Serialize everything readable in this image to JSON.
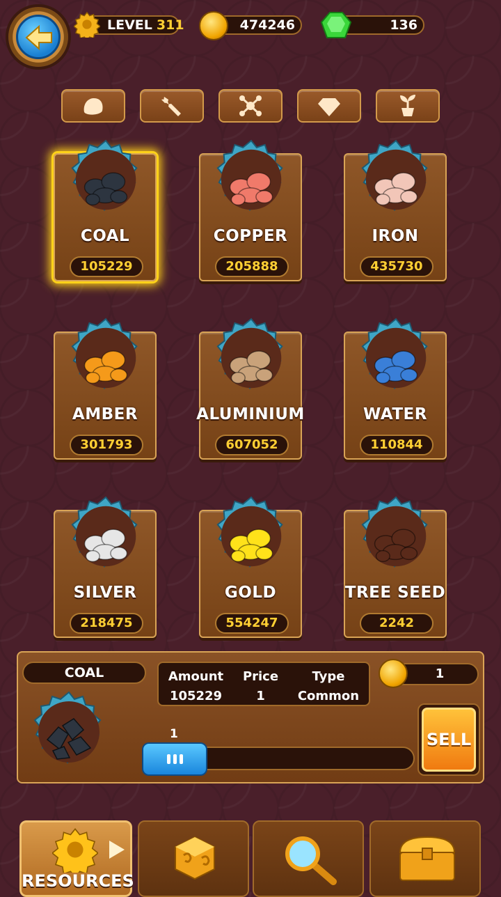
{
  "header": {
    "level_label": "LEVEL",
    "level_value": "311",
    "coins": "474246",
    "gems": "136"
  },
  "tabs": [
    {
      "icon": "rock-icon"
    },
    {
      "icon": "wrench-icon"
    },
    {
      "icon": "molecule-icon"
    },
    {
      "icon": "diamond-icon"
    },
    {
      "icon": "sprout-icon"
    }
  ],
  "resources": [
    {
      "name": "COAL",
      "amount": "105229",
      "color": "#2d3540"
    },
    {
      "name": "COPPER",
      "amount": "205888",
      "color": "#f07a6a"
    },
    {
      "name": "IRON",
      "amount": "435730",
      "color": "#f2c6b8"
    },
    {
      "name": "AMBER",
      "amount": "301793",
      "color": "#f59a1a"
    },
    {
      "name": "ALUMINIUM",
      "amount": "607052",
      "color": "#c9a27a"
    },
    {
      "name": "WATER",
      "amount": "110844",
      "color": "#3a7fd8"
    },
    {
      "name": "SILVER",
      "amount": "218475",
      "color": "#e6e6e6"
    },
    {
      "name": "GOLD",
      "amount": "554247",
      "color": "#ffe21a"
    },
    {
      "name": "TREE SEED",
      "amount": "2242",
      "color": "#5a2a1a"
    }
  ],
  "selected_index": 0,
  "sell_panel": {
    "name": "COAL",
    "amount_label": "Amount",
    "amount_value": "105229",
    "price_label": "Price",
    "price_value": "1",
    "type_label": "Type",
    "type_value": "Common",
    "sell_price": "1",
    "quantity": "1",
    "quantity_fraction": 0.0,
    "sell_label": "SELL"
  },
  "nav": {
    "resources_label": "RESOURCES"
  },
  "colors": {
    "accent_gold": "#ffcf33",
    "slider_blue": "#1a86dc",
    "sell_orange": "#f07a10"
  }
}
